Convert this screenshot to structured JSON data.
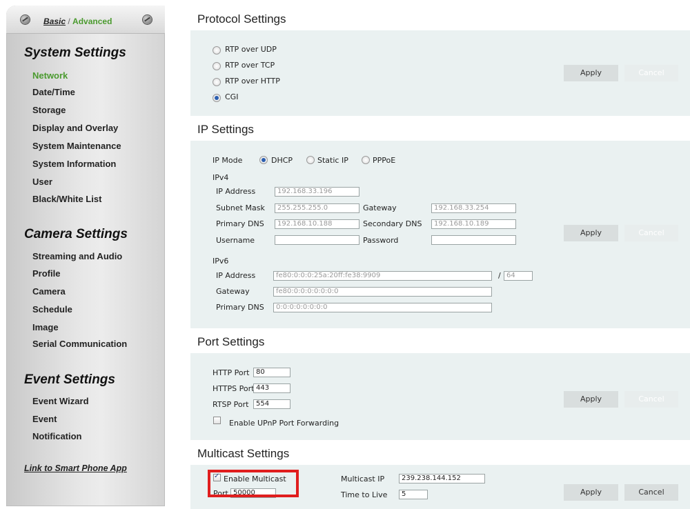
{
  "sidebar": {
    "mode_basic": "Basic",
    "mode_sep": " / ",
    "mode_advanced": "Advanced",
    "system_title": "System Settings",
    "system_items": [
      "Network",
      "Date/Time",
      "Storage",
      "Display and Overlay",
      "System Maintenance",
      "System Information",
      "User",
      "Black/White List"
    ],
    "camera_title": "Camera Settings",
    "camera_items": [
      "Streaming and Audio",
      "Profile",
      "Camera",
      "Schedule",
      "Image",
      "Serial Communication"
    ],
    "event_title": "Event Settings",
    "event_items": [
      "Event Wizard",
      "Event",
      "Notification"
    ],
    "smartphone_link": "Link to Smart Phone App"
  },
  "buttons": {
    "apply": "Apply",
    "cancel": "Cancel"
  },
  "protocol": {
    "title": "Protocol Settings",
    "options": [
      "RTP over UDP",
      "RTP over TCP",
      "RTP over HTTP",
      "CGI"
    ],
    "selected": "CGI"
  },
  "ip": {
    "title": "IP Settings",
    "mode_label": "IP Mode",
    "modes": [
      "DHCP",
      "Static IP",
      "PPPoE"
    ],
    "selected_mode": "DHCP",
    "ipv4_label": "IPv4",
    "ipv4": {
      "ip_address_label": "IP Address",
      "ip_address": "192.168.33.196",
      "subnet_label": "Subnet Mask",
      "subnet": "255.255.255.0",
      "gateway_label": "Gateway",
      "gateway": "192.168.33.254",
      "primary_dns_label": "Primary DNS",
      "primary_dns": "192.168.10.188",
      "secondary_dns_label": "Secondary DNS",
      "secondary_dns": "192.168.10.189",
      "username_label": "Username",
      "username": "",
      "password_label": "Password",
      "password": ""
    },
    "ipv6_label": "IPv6",
    "ipv6": {
      "ip_address_label": "IP Address",
      "ip_address": "fe80:0:0:0:25a:20ff:fe38:9909",
      "prefix_sep": "/",
      "prefix": "64",
      "gateway_label": "Gateway",
      "gateway": "fe80:0:0:0:0:0:0:0",
      "primary_dns_label": "Primary DNS",
      "primary_dns": "0:0:0:0:0:0:0:0"
    }
  },
  "port": {
    "title": "Port Settings",
    "http_label": "HTTP Port",
    "http": "80",
    "https_label": "HTTPS Port",
    "https": "443",
    "rtsp_label": "RTSP Port",
    "rtsp": "554",
    "upnp_label": "Enable UPnP Port Forwarding",
    "upnp_checked": false
  },
  "multicast": {
    "title": "Multicast Settings",
    "enable_label": "Enable Multicast",
    "enable_checked": true,
    "ip_label": "Multicast IP",
    "ip": "239.238.144.152",
    "port_label": "Port",
    "port": "50000",
    "ttl_label": "Time to Live",
    "ttl": "5"
  },
  "colors": {
    "active_green": "#4a9a2e",
    "highlight_red": "#e01e1e",
    "panel_bg": "#eaf1f1"
  }
}
